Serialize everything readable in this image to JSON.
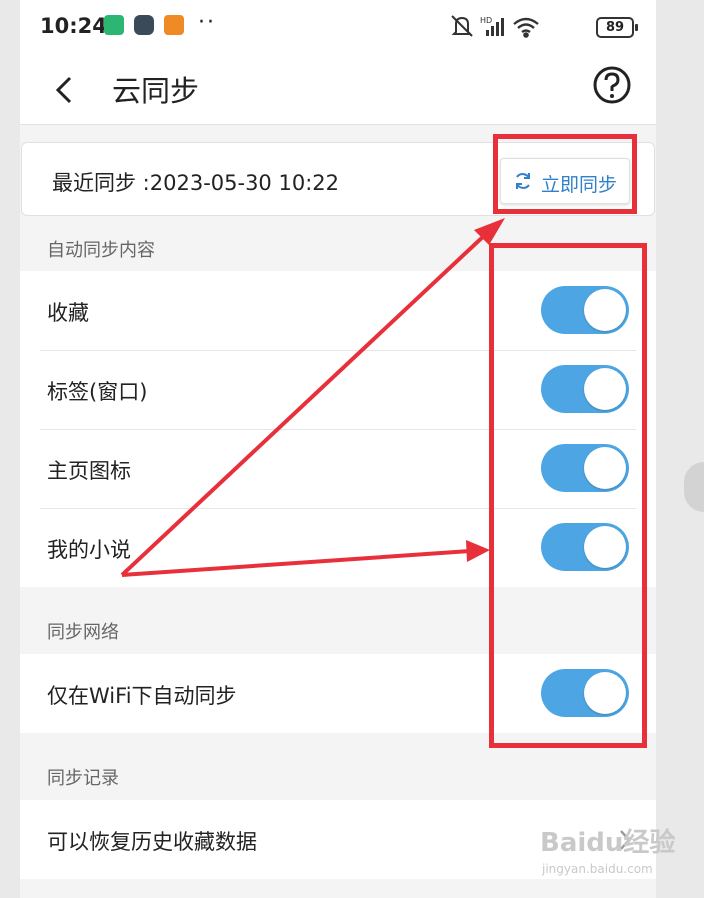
{
  "status_bar": {
    "time": "10:24",
    "battery": "89",
    "app_icons": [
      {
        "name": "messages-icon",
        "color": "#2bb673"
      },
      {
        "name": "browser-icon",
        "color": "#3a4a58"
      },
      {
        "name": "app-icon",
        "color": "#f08a24"
      }
    ],
    "more": "··"
  },
  "header": {
    "title": "云同步"
  },
  "sync": {
    "last_sync": "最近同步 :2023-05-30 10:22",
    "sync_now_label": "立即同步"
  },
  "sections": {
    "auto_sync_content": "自动同步内容",
    "sync_network": "同步网络",
    "sync_records": "同步记录"
  },
  "auto_sync_items": [
    {
      "label": "收藏",
      "on": true
    },
    {
      "label": "标签(窗口)",
      "on": true
    },
    {
      "label": "主页图标",
      "on": true
    },
    {
      "label": "我的小说",
      "on": true
    }
  ],
  "network_items": [
    {
      "label": "仅在WiFi下自动同步",
      "on": true
    }
  ],
  "record_items": [
    {
      "label": "可以恢复历史收藏数据"
    }
  ],
  "watermark": {
    "main": "Baidu经验",
    "sub": "jingyan.baidu.com"
  },
  "colors": {
    "accent": "#4da6e3",
    "link": "#2f82c9",
    "annotation": "#e8303a"
  }
}
